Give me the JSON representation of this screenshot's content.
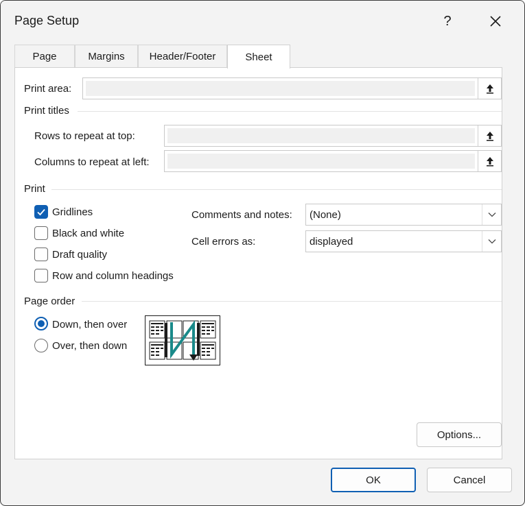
{
  "window": {
    "title": "Page Setup"
  },
  "titlebar": {
    "help_label": "?"
  },
  "tabs": [
    {
      "label": "Page"
    },
    {
      "label": "Margins"
    },
    {
      "label": "Header/Footer"
    },
    {
      "label": "Sheet",
      "active": true
    }
  ],
  "sheet": {
    "print_area_label": "Print area:",
    "print_titles_label": "Print titles",
    "rows_repeat_label": "Rows to repeat at top:",
    "cols_repeat_label": "Columns to repeat at left:",
    "print_section_label": "Print",
    "checkboxes": [
      {
        "label": "Gridlines",
        "checked": true
      },
      {
        "label": "Black and white",
        "checked": false
      },
      {
        "label": "Draft quality",
        "checked": false
      },
      {
        "label": "Row and column headings",
        "checked": false
      }
    ],
    "comments_label": "Comments and notes:",
    "comments_value": "(None)",
    "cell_errors_label": "Cell errors as:",
    "cell_errors_value": "displayed",
    "page_order_label": "Page order",
    "page_order": [
      {
        "label": "Down, then over",
        "selected": true
      },
      {
        "label": "Over, then down",
        "selected": false
      }
    ],
    "options_label": "Options..."
  },
  "footer": {
    "ok_label": "OK",
    "cancel_label": "Cancel"
  },
  "colors": {
    "accent": "#0f5fb3",
    "arrow": "#1a8a8a"
  },
  "icons": [
    "help-icon",
    "close-icon",
    "collapse-dialog-icon",
    "chevron-down-icon",
    "page-order-icon"
  ]
}
